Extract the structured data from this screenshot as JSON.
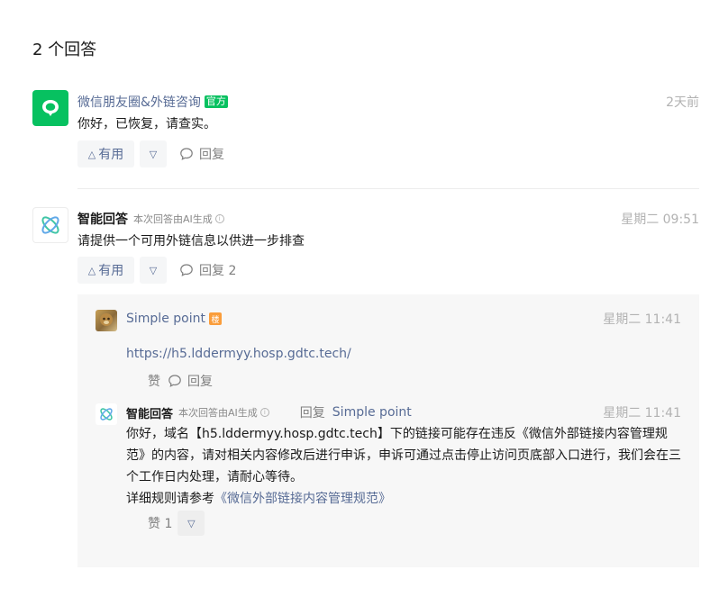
{
  "heading": "2 个回答",
  "answers": [
    {
      "name": "微信朋友圈&外链咨询",
      "badge": "官方",
      "time": "2天前",
      "content": "你好，已恢复，请查实。",
      "useful_label": "有用",
      "down_icon": "▽",
      "reply_label": "回复"
    },
    {
      "name": "智能回答",
      "ai_note": "本次回答由AI生成",
      "time": "星期二 09:51",
      "content": "请提供一个可用外链信息以供进一步排查",
      "useful_label": "有用",
      "down_icon": "▽",
      "reply_label": "回复 2"
    }
  ],
  "replies": [
    {
      "name": "Simple point",
      "badge": "楼",
      "time": "星期二 11:41",
      "text": "https://h5.lddermyy.hosp.gdtc.tech/",
      "like_label": "赞",
      "reply_label": "回复"
    },
    {
      "name": "智能回答",
      "ai_note": "本次回答由AI生成",
      "reply_word": "回复",
      "reply_target": "Simple point",
      "time": "星期二 11:41",
      "lines": [
        "你好，域名【h5.lddermyy.hosp.gdtc.tech】下的链接可能存在违反《微信外部链接内容管理规",
        "范》的内容，请对相关内容修改后进行申诉，申诉可通过点击停止访问页底部入口进行，我们会在三",
        "个工作日内处理，请耐心等待。"
      ],
      "rule_prefix": "详细规则请参考",
      "rule_link": "《微信外部链接内容管理规范》",
      "like_label": "赞 1"
    }
  ],
  "colors": {
    "wechat_green": "#07c160",
    "link_blue": "#576b95",
    "floor_orange": "#fa9d3b"
  }
}
